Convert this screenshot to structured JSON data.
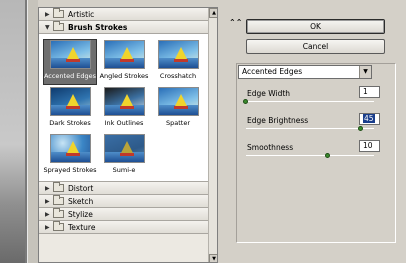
{
  "gallery": {
    "categories_top": [
      {
        "label": "Artistic",
        "expanded": false
      }
    ],
    "open_category": {
      "label": "Brush Strokes",
      "expanded": true
    },
    "thumbnails": [
      {
        "label": "Accented Edges",
        "selected": true,
        "style": "default"
      },
      {
        "label": "Angled Strokes",
        "selected": false,
        "style": "default"
      },
      {
        "label": "Crosshatch",
        "selected": false,
        "style": "default"
      },
      {
        "label": "Dark Strokes",
        "selected": false,
        "style": "dark"
      },
      {
        "label": "Ink Outlines",
        "selected": false,
        "style": "ink"
      },
      {
        "label": "Spatter",
        "selected": false,
        "style": "default"
      },
      {
        "label": "Sprayed Strokes",
        "selected": false,
        "style": "spray"
      },
      {
        "label": "Sumi-e",
        "selected": false,
        "style": "sumi"
      }
    ],
    "categories_bottom": [
      {
        "label": "Distort",
        "expanded": false
      },
      {
        "label": "Sketch",
        "expanded": false
      },
      {
        "label": "Stylize",
        "expanded": false
      },
      {
        "label": "Texture",
        "expanded": false
      }
    ]
  },
  "panel": {
    "collapse_icon": "double-chevron-up-icon",
    "ok_label": "OK",
    "cancel_label": "Cancel",
    "filter_select": {
      "value": "Accented Edges"
    },
    "params": [
      {
        "label": "Edge Width",
        "value": "1",
        "slider_min": 1,
        "slider_max": 14,
        "highlighted": false
      },
      {
        "label": "Edge Brightness",
        "value": "45",
        "slider_min": 0,
        "slider_max": 50,
        "highlighted": true
      },
      {
        "label": "Smoothness",
        "value": "10",
        "slider_min": 1,
        "slider_max": 15,
        "highlighted": false
      }
    ]
  },
  "colors": {
    "panel_bg": "#d4d0c8",
    "selection": "#1a3e8c",
    "slider_knob": "#3c8a2d"
  }
}
